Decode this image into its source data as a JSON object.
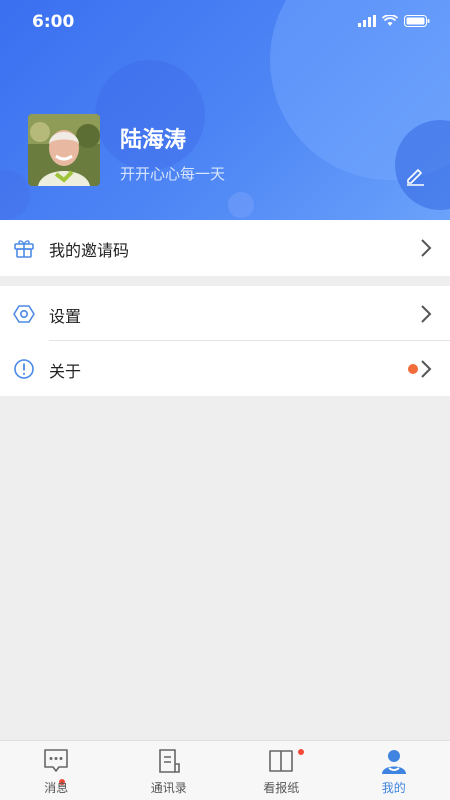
{
  "status_bar": {
    "time": "6:00"
  },
  "profile": {
    "name": "陆海涛",
    "motto": "开开心心每一天"
  },
  "menu": {
    "invite_code": "我的邀请码",
    "settings": "设置",
    "about": "关于"
  },
  "tabs": [
    {
      "label": "消息",
      "icon": "chat-icon",
      "badge": true
    },
    {
      "label": "通讯录",
      "icon": "contacts-icon",
      "badge": false
    },
    {
      "label": "看报纸",
      "icon": "newspaper-icon",
      "badge": true
    },
    {
      "label": "我的",
      "icon": "profile-icon",
      "active": true
    }
  ],
  "colors": {
    "header_blue": "#3a6ff0",
    "accent": "#3f84e0",
    "badge_red": "#f24b3a",
    "about_dot": "#f26b3a"
  }
}
